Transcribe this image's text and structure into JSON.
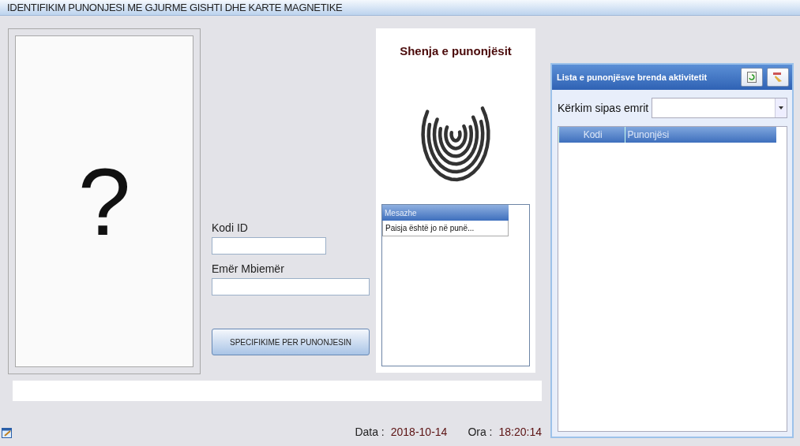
{
  "window": {
    "title": "IDENTIFIKIM PUNONJESI ME GJURME GISHTI DHE KARTE MAGNETIKE"
  },
  "photo": {
    "placeholder_symbol": "?"
  },
  "form": {
    "fields": [
      {
        "label": "Kodi ID"
      },
      {
        "label": "Emër Mbiemër"
      }
    ],
    "button": "SPECIFIKIME PER PUNONJESIN"
  },
  "fingerprint_panel": {
    "title": "Shenja e punonjësit",
    "messages": {
      "header": "Mesazhe",
      "items": [
        "Paisja është jo në punë..."
      ]
    }
  },
  "employee_list": {
    "title": "Lista e punonjësve brenda aktivitetit",
    "search_label": "Kërkim sipas emrit",
    "columns": [
      "Kodi",
      "Punonjësi"
    ]
  },
  "footer": {
    "date_label": "Data :",
    "date": "2018-10-14",
    "time_label": "Ora :",
    "time": "18:20:14"
  }
}
